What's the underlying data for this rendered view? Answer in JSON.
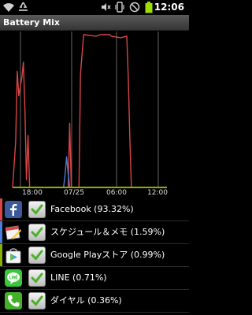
{
  "status_bar": {
    "time": "12:06",
    "icons": [
      "wifi-icon",
      "recycle-icon",
      "muted-icon",
      "vibrate-icon",
      "no-signal-icon",
      "battery-icon"
    ]
  },
  "app": {
    "title": "Battery Mix"
  },
  "chart_data": {
    "type": "line",
    "x_tick_labels": [
      "18:00",
      "07/25",
      "06:00",
      "12:00"
    ],
    "series": [
      {
        "color": "#d94545",
        "points": [
          [
            0,
            0
          ],
          [
            2,
            30
          ],
          [
            3,
            76
          ],
          [
            4,
            60
          ],
          [
            5,
            66
          ],
          [
            6,
            72
          ],
          [
            7,
            82
          ],
          [
            8,
            50
          ],
          [
            9,
            5
          ],
          [
            10,
            34
          ],
          [
            11,
            0
          ],
          [
            36,
            0
          ],
          [
            37,
            42
          ],
          [
            38,
            0
          ],
          [
            43,
            0
          ],
          [
            44,
            74
          ],
          [
            46,
            100
          ],
          [
            54,
            99
          ],
          [
            57,
            100
          ],
          [
            63,
            100
          ],
          [
            64,
            99
          ],
          [
            70,
            98
          ],
          [
            74,
            99
          ],
          [
            75,
            70
          ],
          [
            76,
            30
          ],
          [
            77,
            0
          ],
          [
            100,
            0
          ]
        ]
      },
      {
        "color": "#4a7fd9",
        "points": [
          [
            0,
            0
          ],
          [
            33,
            0
          ],
          [
            34,
            8
          ],
          [
            35,
            20
          ],
          [
            36,
            9
          ],
          [
            37,
            0
          ],
          [
            100,
            0
          ]
        ]
      },
      {
        "color": "#8ab000",
        "points": [
          [
            0,
            0
          ],
          [
            100,
            0
          ]
        ]
      }
    ],
    "ylim": [
      0,
      100
    ]
  },
  "apps": [
    {
      "label": "Facebook (93.32%)",
      "color": "#d94545",
      "icon": "facebook-icon",
      "checked": true
    },
    {
      "label": "スケジュール＆メモ (1.59%)",
      "color": "#4a7fd9",
      "icon": "schedule-memo-icon",
      "checked": true
    },
    {
      "label": "Google Playストア (0.99%)",
      "color": "#8ab000",
      "icon": "google-play-store-icon",
      "checked": true
    },
    {
      "label": "LINE (0.71%)",
      "color": "#000000",
      "icon": "line-icon",
      "checked": true
    },
    {
      "label": "ダイヤル (0.36%)",
      "color": "#000000",
      "icon": "phone-dial-icon",
      "checked": true
    }
  ]
}
